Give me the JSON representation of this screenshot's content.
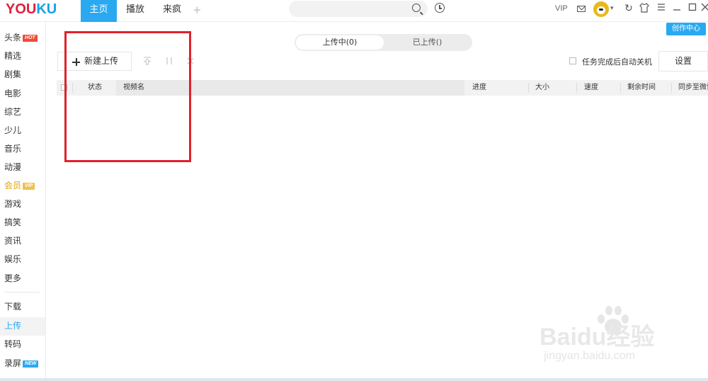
{
  "app": {
    "logo_left": "YOU",
    "logo_right": "KU"
  },
  "topnav": {
    "tabs": [
      "主页",
      "播放",
      "来疯"
    ],
    "add_tab": "+",
    "vip_label": "VIP"
  },
  "creator_center": "创作中心",
  "sidebar": {
    "items": [
      {
        "label": "头条",
        "badge": "HOT"
      },
      {
        "label": "精选"
      },
      {
        "label": "剧集"
      },
      {
        "label": "电影"
      },
      {
        "label": "综艺"
      },
      {
        "label": "少儿"
      },
      {
        "label": "音乐"
      },
      {
        "label": "动漫"
      },
      {
        "label": "会员",
        "badge": "VIP"
      },
      {
        "label": "游戏"
      },
      {
        "label": "搞笑"
      },
      {
        "label": "资讯"
      },
      {
        "label": "娱乐"
      },
      {
        "label": "更多"
      }
    ],
    "bottom_items": [
      {
        "label": "下载"
      },
      {
        "label": "上传"
      },
      {
        "label": "转码"
      },
      {
        "label": "录屏",
        "badge": "NEW"
      }
    ],
    "active": "上传"
  },
  "upload": {
    "tab_uploading": "上传中(0)",
    "tab_uploaded": "已上传()",
    "new_upload_label": "新建上传",
    "auto_shutdown_label": "任务完成后自动关机",
    "settings_label": "设置"
  },
  "table": {
    "columns": [
      "状态",
      "视频名",
      "进度",
      "大小",
      "速度",
      "剩余时间",
      "同步至微博"
    ]
  },
  "watermark": {
    "big": "Baidu经验",
    "small": "jingyan.baidu.com"
  },
  "colors": {
    "accent": "#2aa9f1",
    "logo_red": "#e0213d",
    "highlight_red": "#e0212b"
  }
}
